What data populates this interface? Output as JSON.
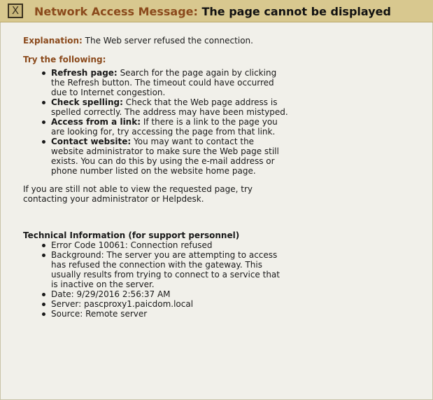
{
  "header": {
    "close_glyph": "X",
    "title_lead": "Network Access Message:",
    "title_main": "The page cannot be displayed"
  },
  "explanation": {
    "label": "Explanation:",
    "text": "The Web server refused the connection."
  },
  "try": {
    "heading": "Try the following:",
    "items": [
      {
        "label": "Refresh page:",
        "text": "Search for the page again by clicking the Refresh button. The timeout could have occurred due to Internet congestion."
      },
      {
        "label": "Check spelling:",
        "text": "Check that the Web page address is spelled correctly. The address may have been mistyped."
      },
      {
        "label": "Access from a link:",
        "text": "If there is a link to the page you are looking for, try accessing the page from that link."
      },
      {
        "label": "Contact website:",
        "text": "You may want to contact the website administrator to make sure the Web page still exists. You can do this by using the e-mail address or phone number listed on the website home page."
      }
    ]
  },
  "still_text": "If you are still not able to view the requested page, try contacting your administrator or Helpdesk.",
  "technical": {
    "heading": "Technical Information (for support personnel)",
    "items": [
      "Error Code 10061: Connection refused",
      "Background: The server you are attempting to access has refused the connection with the gateway. This usually results from trying to connect to a service that is inactive on the server.",
      "Date: 9/29/2016 2:56:37 AM",
      "Server: pascproxy1.paicdom.local",
      "Source: Remote server"
    ]
  }
}
